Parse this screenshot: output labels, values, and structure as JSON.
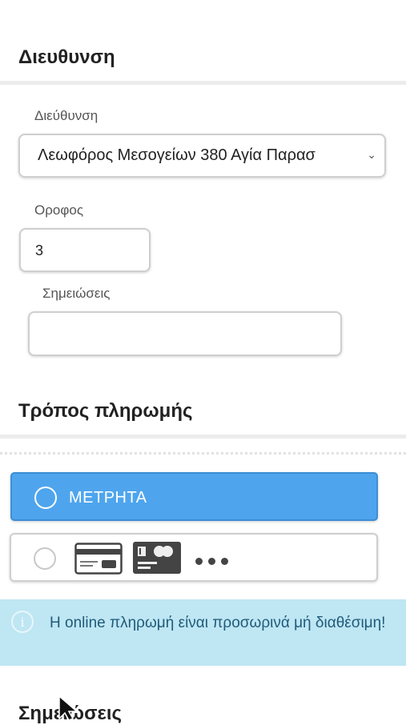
{
  "address_section": {
    "title": "Διευθυνση",
    "address_label": "Διεύθυνση",
    "address_value": "Λεωφόρος Μεσογείων 380 Αγία Παρασ",
    "floor_label": "Οροφος",
    "floor_value": "3",
    "notes_label": "Σημειώσεις",
    "notes_value": ""
  },
  "payment_section": {
    "title": "Τρόπος πληρωμής",
    "cash_label": "ΜΕΤΡΗΤΑ",
    "card_icons": [
      "credit-card-icon",
      "card-brand-icon",
      "more-options-icon"
    ],
    "info_message": "Η online πληρωμή είναι προσωρινά μή διαθέσιμη!"
  },
  "notes_section": {
    "title": "Σημειώσεις"
  },
  "colors": {
    "cash_selected_bg": "#4ea5ed",
    "info_bg": "#bfe6f3",
    "info_text": "#1f5b7a"
  }
}
